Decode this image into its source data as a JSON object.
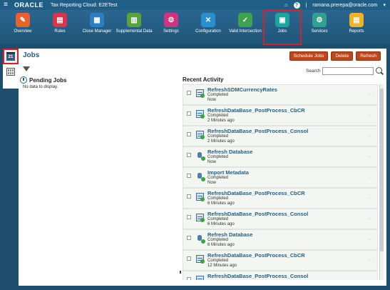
{
  "brand": {
    "menu_icon": "hamburger-icon",
    "logo_text": "ORACLE",
    "app_title": "Tax Reporting Cloud: E2ETest",
    "home_icon": "home-icon",
    "help_icon": "help-icon",
    "user": "ramana.prerepa@oracle.com"
  },
  "nav": {
    "items": [
      {
        "label": "Overview",
        "color": "#e8622e",
        "icon": "overview-icon"
      },
      {
        "label": "Rules",
        "color": "#d9344a",
        "icon": "rules-icon"
      },
      {
        "label": "Close Manager",
        "color": "#2b7fc7",
        "icon": "close-manager-icon"
      },
      {
        "label": "Supplemental Data",
        "color": "#5aa23c",
        "icon": "supplemental-data-icon"
      },
      {
        "label": "Settings",
        "color": "#d0347f",
        "icon": "settings-icon"
      },
      {
        "label": "Configuration",
        "color": "#2a8fcf",
        "icon": "configuration-icon"
      },
      {
        "label": "Valid Intersection",
        "color": "#3fa34d",
        "icon": "valid-intersection-icon"
      },
      {
        "label": "Jobs",
        "color": "#1aa69a",
        "icon": "jobs-icon"
      },
      {
        "label": "Services",
        "color": "#2ea28f",
        "icon": "services-icon"
      },
      {
        "label": "Reports",
        "color": "#f0b323",
        "icon": "reports-icon"
      }
    ],
    "selected": "Jobs"
  },
  "page": {
    "title": "Jobs",
    "side_tab_cal": "21",
    "buttons": {
      "schedule": "Schedule Jobs",
      "delete": "Delete",
      "refresh": "Refresh"
    },
    "search_label": "Search",
    "search_value": ""
  },
  "pending": {
    "heading": "Pending Jobs",
    "empty_text": "No data to display."
  },
  "recent": {
    "heading": "Recent Activity",
    "items": [
      {
        "name": "RefreshSDMCurrencyRates",
        "status": "Completed",
        "time": "Now",
        "icon": "grid"
      },
      {
        "name": "RefreshDataBase_PostProcess_CbCR",
        "status": "Completed",
        "time": "2 Minutes ago",
        "icon": "grid"
      },
      {
        "name": "RefreshDataBase_PostProcess_Consol",
        "status": "Completed",
        "time": "2 Minutes ago",
        "icon": "grid"
      },
      {
        "name": "Refresh Database",
        "status": "Completed",
        "time": "Now",
        "icon": "db"
      },
      {
        "name": "Import Metadata",
        "status": "Completed",
        "time": "Now",
        "icon": "db"
      },
      {
        "name": "RefreshDataBase_PostProcess_CbCR",
        "status": "Completed",
        "time": "6 Minutes ago",
        "icon": "grid"
      },
      {
        "name": "RefreshDataBase_PostProcess_Consol",
        "status": "Completed",
        "time": "6 Minutes ago",
        "icon": "grid"
      },
      {
        "name": "Refresh Database",
        "status": "Completed",
        "time": "6 Minutes ago",
        "icon": "db"
      },
      {
        "name": "RefreshDataBase_PostProcess_CbCR",
        "status": "Completed",
        "time": "12 Minutes ago",
        "icon": "grid"
      },
      {
        "name": "RefreshDataBase_PostProcess_Consol",
        "status": "",
        "time": "",
        "icon": "grid"
      }
    ]
  }
}
